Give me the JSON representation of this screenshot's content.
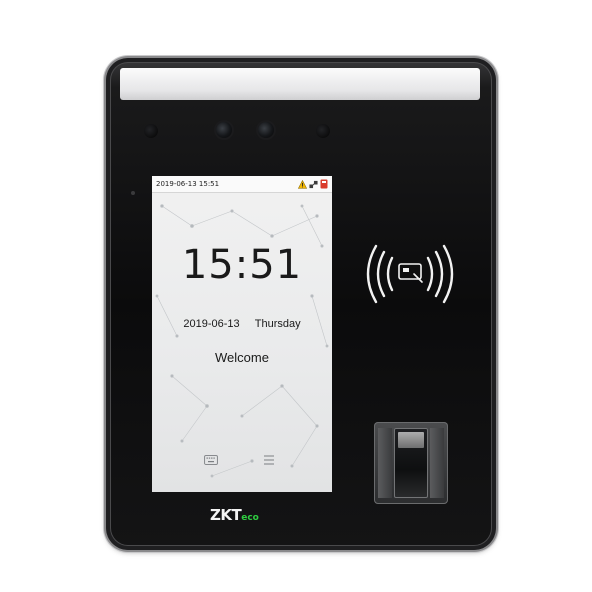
{
  "statusbar": {
    "datetime": "2019-06-13 15:51",
    "icons": [
      "warning-icon",
      "network-icon",
      "card-icon"
    ]
  },
  "screen": {
    "time": "15:51",
    "date": "2019-06-13",
    "weekday": "Thursday",
    "welcome": "Welcome",
    "buttons": [
      "keyboard-icon",
      "menu-icon"
    ]
  },
  "device": {
    "brand_main": "ZKT",
    "brand_suffix": "eco",
    "brand_color": "#f4f4f4",
    "brand_accent_color": "#2ecc40"
  },
  "colors": {
    "body": "#0b0b0c",
    "screen_bg": "#eaebec",
    "warning": "#f2b705",
    "card": "#d93a2b"
  }
}
